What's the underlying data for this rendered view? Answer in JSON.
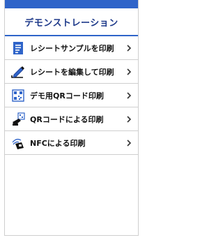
{
  "header": {
    "title": "デモンストレーション"
  },
  "menu": {
    "items": [
      {
        "label": "レシートサンプルを印刷",
        "icon": "receipt-icon"
      },
      {
        "label": "レシートを編集して印刷",
        "icon": "edit-pencil-icon"
      },
      {
        "label": "デモ用QRコード印刷",
        "icon": "qr-code-icon"
      },
      {
        "label": "QRコードによる印刷",
        "icon": "qr-scan-icon"
      },
      {
        "label": "NFCによる印刷",
        "icon": "nfc-icon"
      }
    ],
    "arrow": "chevron-right-icon"
  },
  "colors": {
    "accent": "#2f64c9",
    "title": "#1e3a8a"
  }
}
